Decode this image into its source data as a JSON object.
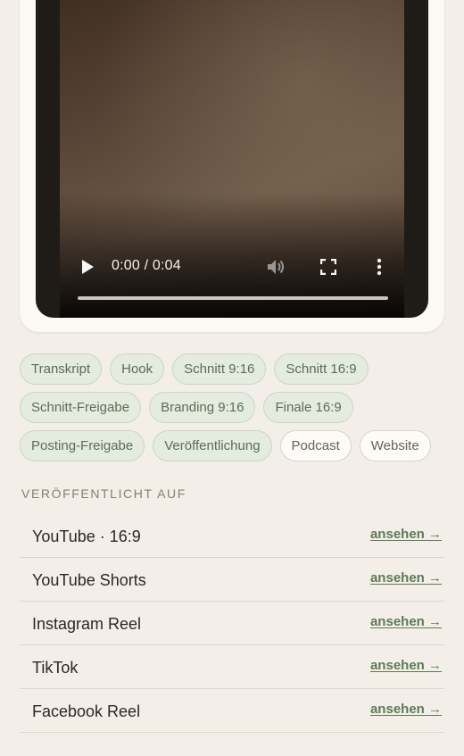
{
  "video": {
    "time_display": "0:00 / 0:04",
    "progress": 0,
    "icons": [
      "play-icon",
      "volume-icon",
      "fullscreen-icon",
      "more-vertical-icon"
    ]
  },
  "workflow_tags": {
    "rows": [
      [
        {
          "label": "Transkript",
          "status": "done"
        },
        {
          "label": "Hook",
          "status": "done"
        },
        {
          "label": "Schnitt 9:16",
          "status": "done"
        },
        {
          "label": "Schnitt 16:9",
          "status": "done"
        }
      ],
      [
        {
          "label": "Schnitt-Freigabe",
          "status": "done"
        },
        {
          "label": "Branding 9:16",
          "status": "done"
        },
        {
          "label": "Finale 16:9",
          "status": "done"
        }
      ],
      [
        {
          "label": "Posting-Freigabe",
          "status": "done"
        },
        {
          "label": "Veröffentlichung",
          "status": "done"
        },
        {
          "label": "Podcast",
          "status": "open"
        },
        {
          "label": "Website",
          "status": "open"
        }
      ]
    ]
  },
  "published": {
    "heading": "VERÖFFENTLICHT AUF",
    "link_label": "ansehen →",
    "platforms": [
      {
        "name": "YouTube · 16:9"
      },
      {
        "name": "YouTube Shorts"
      },
      {
        "name": "Instagram Reel"
      },
      {
        "name": "TikTok"
      },
      {
        "name": "Facebook Reel"
      }
    ]
  },
  "colors": {
    "page_background": "#f3efe8",
    "tag_done_background": "#e4ebdf",
    "tag_done_text": "#5b6e55",
    "tag_open_background": "#fdfbf7",
    "link": "#5d7a57",
    "section_label": "#8a7d6b"
  }
}
